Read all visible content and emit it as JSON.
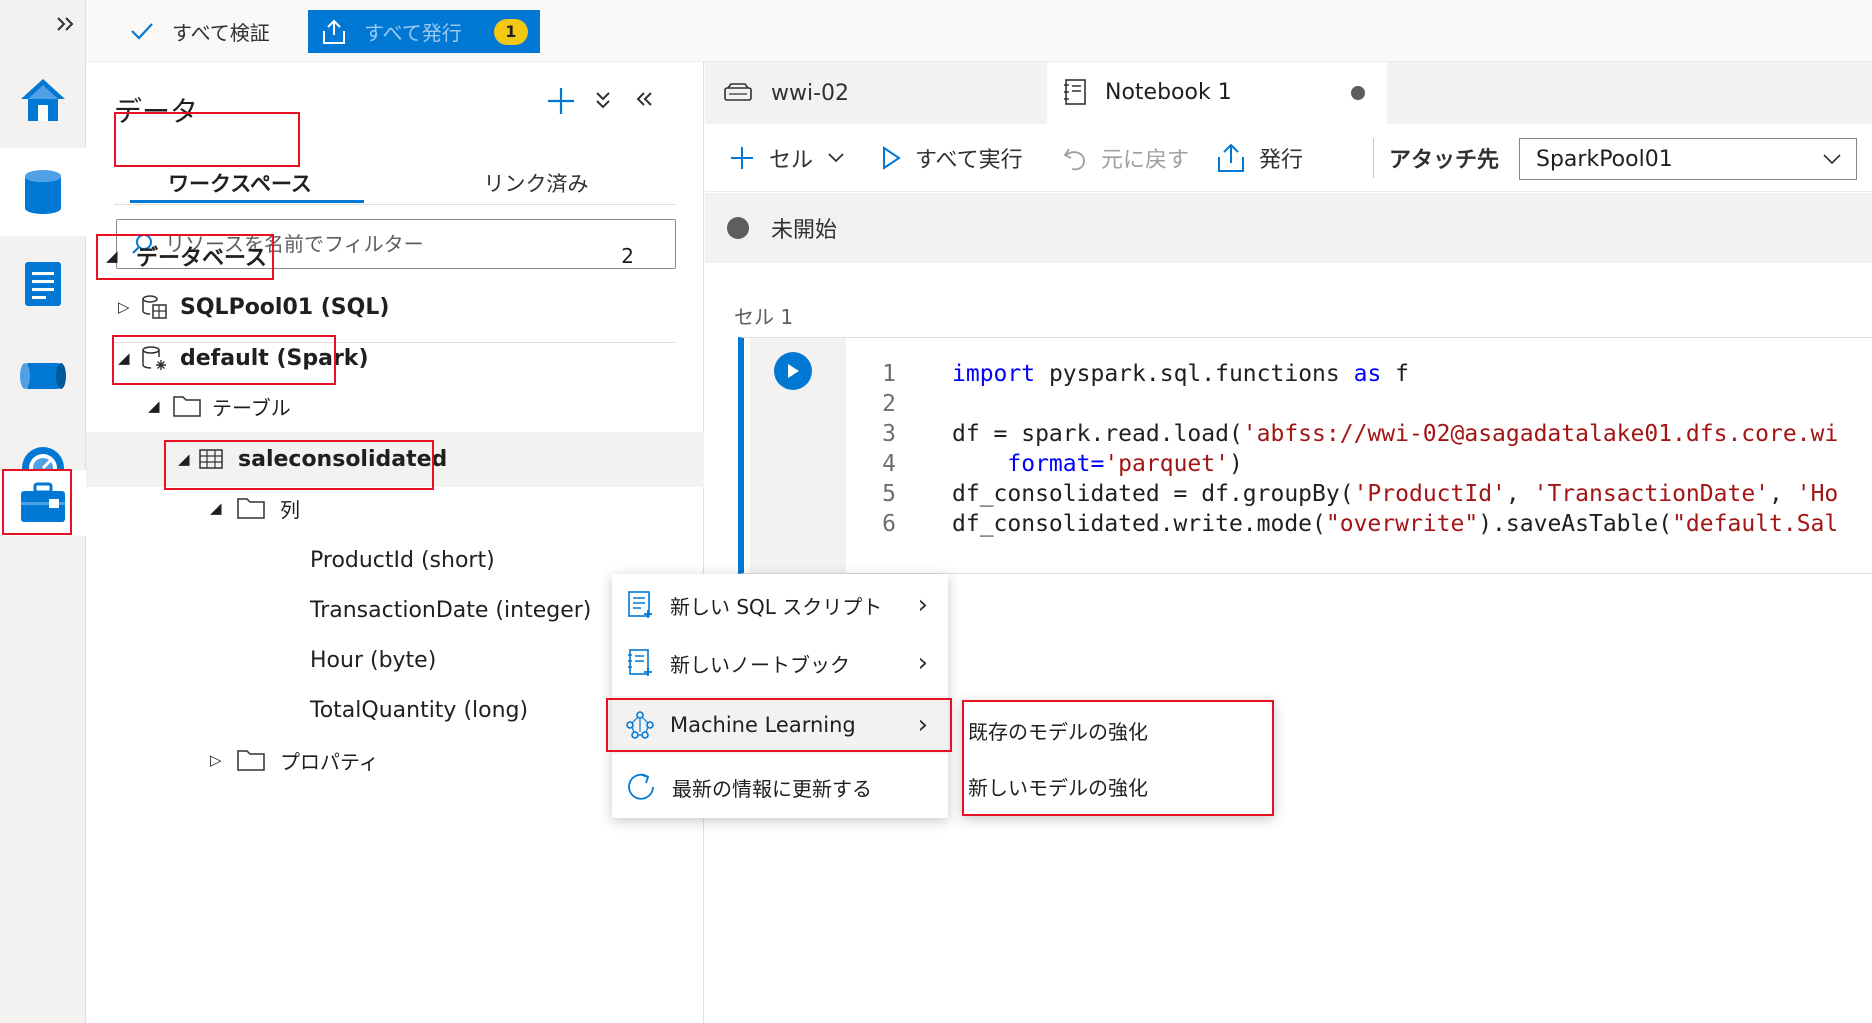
{
  "rail": {
    "items": [
      "expand",
      "home",
      "data",
      "develop",
      "integrate",
      "monitor",
      "manage"
    ]
  },
  "topbar": {
    "validate_label": "すべて検証",
    "publish_label": "すべて発行",
    "publish_count": "1"
  },
  "data_pane": {
    "title": "データ",
    "tabs": {
      "workspace": "ワークスペース",
      "linked": "リンク済み"
    },
    "filter_placeholder": "リソースを名前でフィルター",
    "databases_label": "データベース",
    "databases_count": "2",
    "tree": {
      "sqlpool": "SQLPool01 (SQL)",
      "default_db": "default (Spark)",
      "tables_folder": "テーブル",
      "table": "saleconsolidated",
      "columns_folder": "列",
      "columns": [
        "ProductId (short)",
        "TransactionDate (integer)",
        "Hour (byte)",
        "TotalQuantity (long)"
      ],
      "properties_folder": "プロパティ"
    }
  },
  "editor": {
    "tabs": [
      {
        "label": "wwi-02"
      },
      {
        "label": "Notebook 1"
      }
    ],
    "toolbar": {
      "cell": "セル",
      "run_all": "すべて実行",
      "undo": "元に戻す",
      "publish": "発行",
      "attach_to": "アタッチ先",
      "pool": "SparkPool01"
    },
    "status": "未開始",
    "cell_label": "セル 1",
    "code": {
      "lines": [
        "1",
        "2",
        "3",
        "4",
        "5",
        "6"
      ],
      "l1_import": "import",
      "l1_mid": " pyspark.sql.functions ",
      "l1_as": "as",
      "l1_end": " f",
      "l3_a": "df = spark.read.load(",
      "l3_str": "'abfss://wwi-02@asagadatalake01.dfs.core.wi",
      "l4_a": "    format=",
      "l4_str": "'parquet'",
      "l4_end": ")",
      "l5_a": "df_consolidated = df.groupBy(",
      "l5_s1": "'ProductId'",
      "l5_c1": ", ",
      "l5_s2": "'TransactionDate'",
      "l5_c2": ", ",
      "l5_s3": "'Ho",
      "l6_a": "df_consolidated.write.mode(",
      "l6_s1": "\"overwrite\"",
      "l6_b": ").saveAsTable(",
      "l6_s2": "\"default.Sal"
    }
  },
  "context_menu": {
    "items": [
      "新しい SQL スクリプト",
      "新しいノートブック",
      "Machine Learning",
      "最新の情報に更新する"
    ]
  },
  "submenu": {
    "items": [
      "既存のモデルの強化",
      "新しいモデルの強化"
    ]
  },
  "colors": {
    "accent": "#0078d4",
    "highlight_box": "#e81123",
    "badge": "#f2c811"
  }
}
